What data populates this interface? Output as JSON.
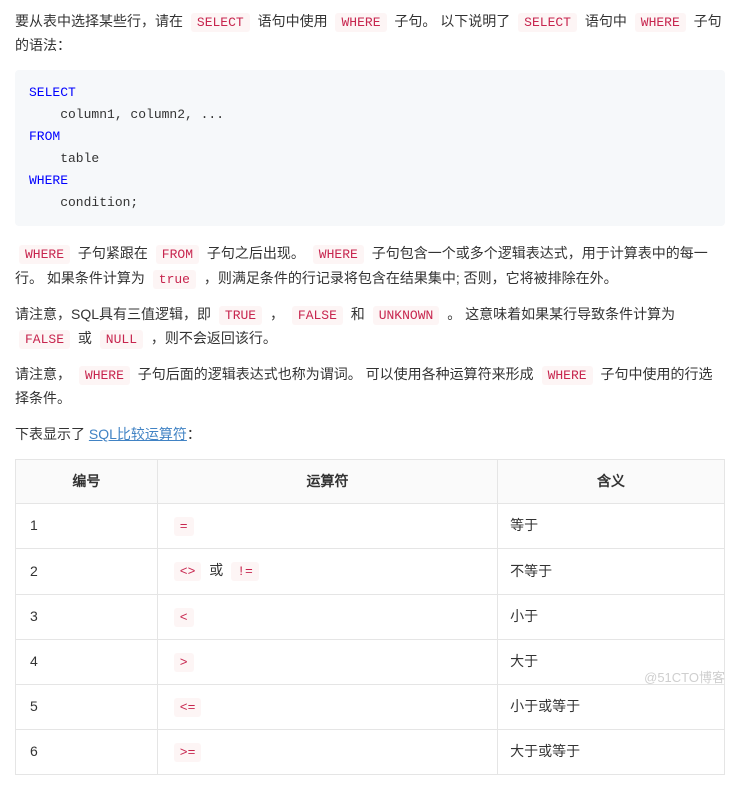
{
  "intro": {
    "prefix": "要从表中选择某些行，请在 ",
    "select": "SELECT",
    "mid1": " 语句中使用 ",
    "where": "WHERE",
    "mid2": " 子句。 以下说明了 ",
    "select2": "SELECT",
    "mid3": " 语句中 ",
    "where2": "WHERE",
    "suffix": " 子句的语法："
  },
  "code": {
    "kw_select": "SELECT",
    "line_cols": "    column1, column2, ...",
    "kw_from": "FROM",
    "line_table": "    table",
    "kw_where": "WHERE",
    "line_cond": "    condition;"
  },
  "para2": {
    "where": "WHERE",
    "t1": " 子句紧跟在 ",
    "from": "FROM",
    "t2": " 子句之后出现。 ",
    "where2": "WHERE",
    "t3": " 子句包含一个或多个逻辑表达式，用于计算表中的每一行。 如果条件计算为 ",
    "true": "true",
    "t4": " ，则满足条件的行记录将包含在结果集中; 否则，它将被排除在外。"
  },
  "para3": {
    "t1": "请注意，SQL具有三值逻辑，即 ",
    "true": "TRUE",
    "t2": " ， ",
    "false": "FALSE",
    "t3": " 和 ",
    "unknown": "UNKNOWN",
    "t4": " 。 这意味着如果某行导致条件计算为 ",
    "false2": "FALSE",
    "t5": " 或 ",
    "null": "NULL",
    "t6": " ，则不会返回该行。"
  },
  "para4": {
    "t1": "请注意， ",
    "where": "WHERE",
    "t2": " 子句后面的逻辑表达式也称为谓词。 可以使用各种运算符来形成 ",
    "where2": "WHERE",
    "t3": " 子句中使用的行选择条件。"
  },
  "table_intro": {
    "prefix": "下表显示了 ",
    "link_text": "SQL比较运算符",
    "suffix": "："
  },
  "table": {
    "headers": {
      "h1": "编号",
      "h2": "运算符",
      "h3": "含义"
    },
    "rows": [
      {
        "no": "1",
        "ops": [
          "="
        ],
        "sep": [],
        "meaning": "等于"
      },
      {
        "no": "2",
        "ops": [
          "<>",
          "!="
        ],
        "sep": [
          " 或 "
        ],
        "meaning": "不等于"
      },
      {
        "no": "3",
        "ops": [
          "<"
        ],
        "sep": [],
        "meaning": "小于"
      },
      {
        "no": "4",
        "ops": [
          ">"
        ],
        "sep": [],
        "meaning": "大于"
      },
      {
        "no": "5",
        "ops": [
          "<="
        ],
        "sep": [],
        "meaning": "小于或等于"
      },
      {
        "no": "6",
        "ops": [
          ">="
        ],
        "sep": [],
        "meaning": "大于或等于"
      }
    ]
  },
  "watermark": "@51CTO博客"
}
